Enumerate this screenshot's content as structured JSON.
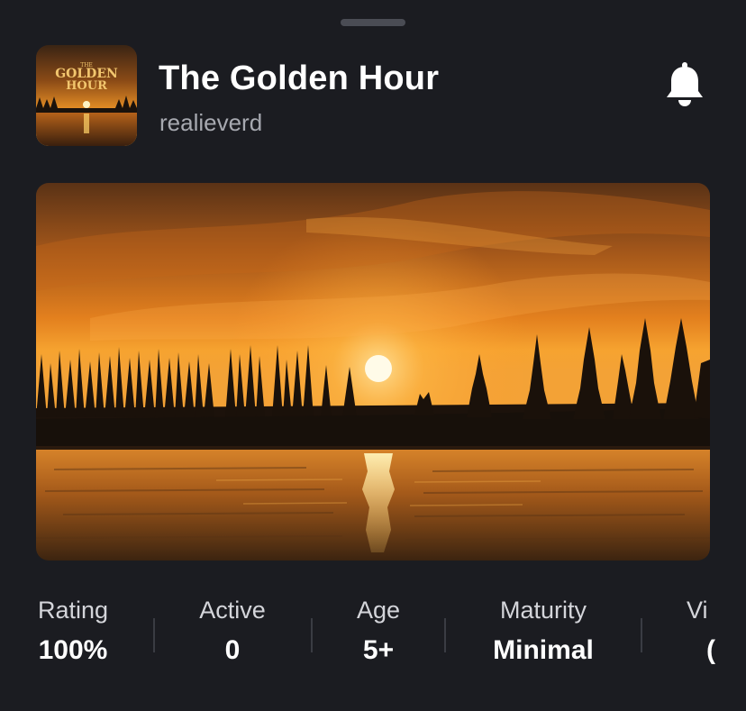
{
  "header": {
    "title": "The Golden Hour",
    "creator": "realieverd",
    "thumbnail_text_line1": "THE",
    "thumbnail_text_line2": "GOLDEN",
    "thumbnail_text_line3": "HOUR"
  },
  "icons": {
    "notification": "bell-icon"
  },
  "stats": [
    {
      "label": "Rating",
      "value": "100%"
    },
    {
      "label": "Active",
      "value": "0"
    },
    {
      "label": "Age",
      "value": "5+"
    },
    {
      "label": "Maturity",
      "value": "Minimal"
    },
    {
      "label": "Vi",
      "value": "("
    }
  ],
  "colors": {
    "background": "#1b1c21",
    "sunset_orange": "#e8861c",
    "text_secondary": "#a7a9b0"
  }
}
